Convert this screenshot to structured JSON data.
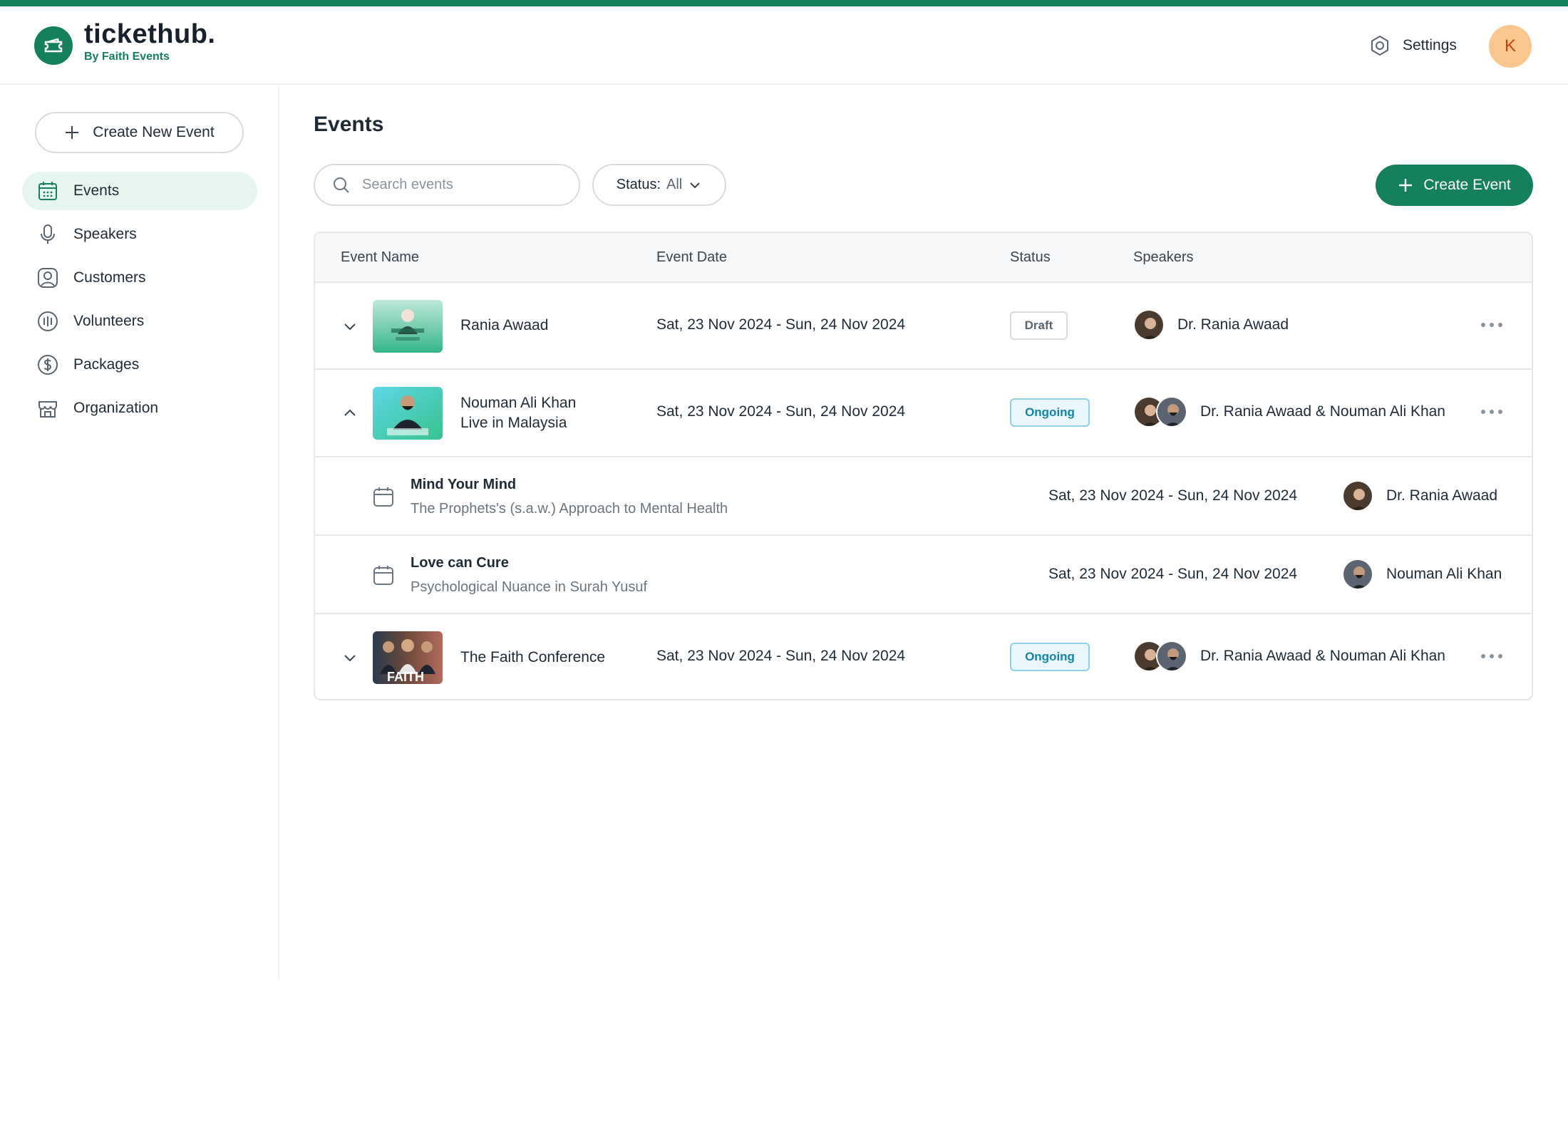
{
  "brand": {
    "name": "tickethub.",
    "subtitle": "By Faith Events",
    "accent": "#15805c"
  },
  "header": {
    "settings_label": "Settings",
    "user_initial": "K"
  },
  "sidebar": {
    "create_label": "Create New Event",
    "items": [
      {
        "label": "Events",
        "icon": "calendar-icon",
        "active": true
      },
      {
        "label": "Speakers",
        "icon": "microphone-icon"
      },
      {
        "label": "Customers",
        "icon": "user-icon"
      },
      {
        "label": "Volunteers",
        "icon": "volunteers-icon"
      },
      {
        "label": "Packages",
        "icon": "dollar-icon"
      },
      {
        "label": "Organization",
        "icon": "store-icon"
      }
    ]
  },
  "main": {
    "title": "Events",
    "search_placeholder": "Search events",
    "status_filter": {
      "label": "Status:",
      "value": "All"
    },
    "create_event_label": "Create Event"
  },
  "table": {
    "headers": [
      "Event Name",
      "Event Date",
      "Status",
      "Speakers"
    ],
    "rows": [
      {
        "name": "Rania Awaad",
        "date": "Sat, 23 Nov 2024 - Sun, 24 Nov 2024",
        "status": "Draft",
        "speakers": "Dr. Rania Awaad",
        "expanded": false
      },
      {
        "name_line1": "Nouman Ali Khan",
        "name_line2": "Live in Malaysia",
        "date": "Sat, 23 Nov 2024 - Sun, 24 Nov 2024",
        "status": "Ongoing",
        "speakers": "Dr. Rania Awaad & Nouman Ali Khan",
        "expanded": true,
        "sessions": [
          {
            "title": "Mind Your Mind",
            "description": "The Prophets's (s.a.w.) Approach to Mental Health",
            "date": "Sat, 23 Nov 2024 - Sun, 24 Nov 2024",
            "speaker": "Dr. Rania Awaad"
          },
          {
            "title": "Love can Cure",
            "description": "Psychological Nuance in Surah Yusuf",
            "date": "Sat, 23 Nov 2024 - Sun, 24 Nov 2024",
            "speaker": "Nouman Ali Khan"
          }
        ]
      },
      {
        "name": "The Faith Conference",
        "date": "Sat, 23 Nov 2024 - Sun, 24 Nov 2024",
        "status": "Ongoing",
        "speakers": "Dr. Rania Awaad & Nouman Ali Khan",
        "expanded": false,
        "thumb_text": "FAITH"
      }
    ]
  }
}
